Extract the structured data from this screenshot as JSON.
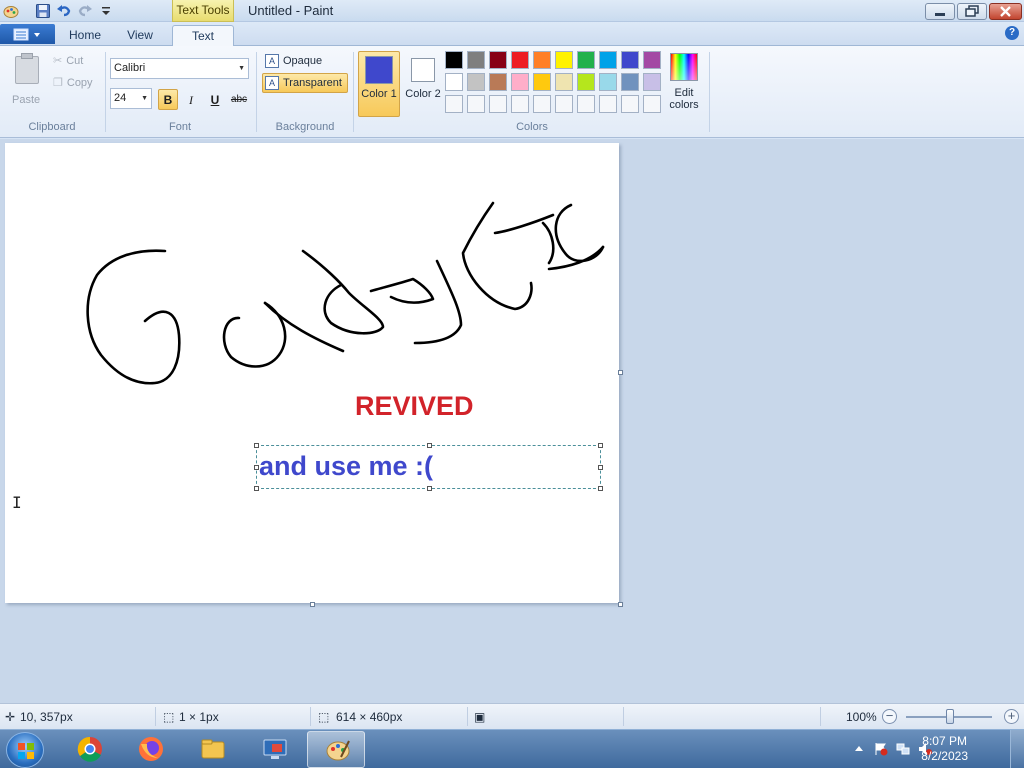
{
  "window": {
    "title": "Untitled - Paint",
    "context_tab": "Text Tools"
  },
  "ribbon_tabs": [
    "Home",
    "View",
    "Text"
  ],
  "active_tab": "Text",
  "clipboard": {
    "paste": "Paste",
    "cut": "Cut",
    "copy": "Copy",
    "group": "Clipboard"
  },
  "font": {
    "family": "Calibri",
    "size": "24",
    "bold": "B",
    "italic": "I",
    "underline": "U",
    "strikethrough": "abc",
    "group": "Font",
    "bold_active": true
  },
  "background": {
    "opaque": "Opaque",
    "transparent": "Transparent",
    "group": "Background",
    "selected": "Transparent"
  },
  "colors": {
    "color1_label": "Color 1",
    "color2_label": "Color 2",
    "color1": "#3f48cc",
    "color2": "#ffffff",
    "edit_colors": "Edit colors",
    "group": "Colors",
    "palette": [
      [
        "#000000",
        "#7f7f7f",
        "#880015",
        "#ed1c24",
        "#ff7f27",
        "#fff200",
        "#22b14c",
        "#00a2e8",
        "#3f48cc",
        "#a349a4"
      ],
      [
        "#ffffff",
        "#c3c3c3",
        "#b97a57",
        "#ffaec9",
        "#ffc90e",
        "#efe4b0",
        "#b5e61d",
        "#99d9ea",
        "#7092be",
        "#c8bfe7"
      ],
      [
        "#f5f7fa",
        "#f5f7fa",
        "#f5f7fa",
        "#f5f7fa",
        "#f5f7fa",
        "#f5f7fa",
        "#f5f7fa",
        "#f5f7fa",
        "#f5f7fa",
        "#f5f7fa"
      ]
    ]
  },
  "canvas": {
    "handwriting_word": "Gadgets",
    "revived_text": "REVIVED",
    "revived_color": "#d2232a",
    "textbox_text": "and use me :(",
    "textbox_color": "#3f48cc"
  },
  "statusbar": {
    "cursor_pos": "10, 357px",
    "selection_size": "1 × 1px",
    "image_size": "614 × 460px",
    "zoom": "100%",
    "zoom_level": 1.0
  },
  "taskbar": {
    "time": "8:07 PM",
    "date": "8/2/2023",
    "apps": [
      "chrome-icon",
      "firefox-icon",
      "explorer-icon",
      "remote-desktop-icon",
      "paint-icon"
    ]
  }
}
